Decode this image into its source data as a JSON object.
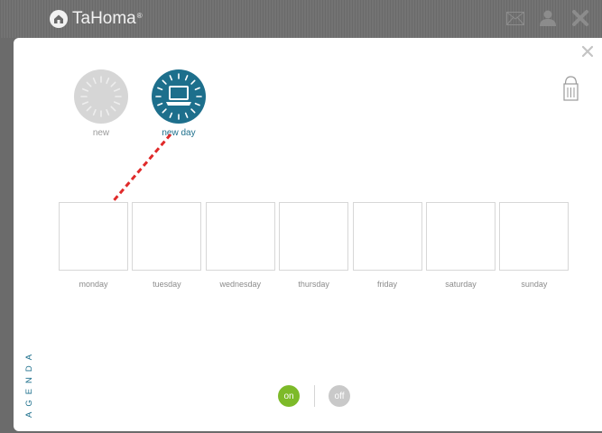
{
  "app": {
    "name": "TaHoma",
    "registered_mark": "®"
  },
  "topbar": {
    "icons": [
      "envelope-icon",
      "user-icon",
      "tools-icon"
    ]
  },
  "dialog": {
    "close_icon": "close-icon",
    "trash_icon": "trash-icon",
    "scenarios": [
      {
        "label": "new",
        "state": "inactive",
        "color": "#d6d6d6"
      },
      {
        "label": "new day",
        "state": "active",
        "color": "#1d6f8c",
        "icon": "laptop-icon"
      }
    ],
    "days": [
      "monday",
      "tuesday",
      "wednesday",
      "thursday",
      "friday",
      "saturday",
      "sunday"
    ],
    "side_label": "AGENDA",
    "toggle": {
      "on": "on",
      "off": "off",
      "on_color": "#7dba29",
      "off_color": "#c9c9c9"
    },
    "drag_hint_color": "#e02a2a"
  }
}
